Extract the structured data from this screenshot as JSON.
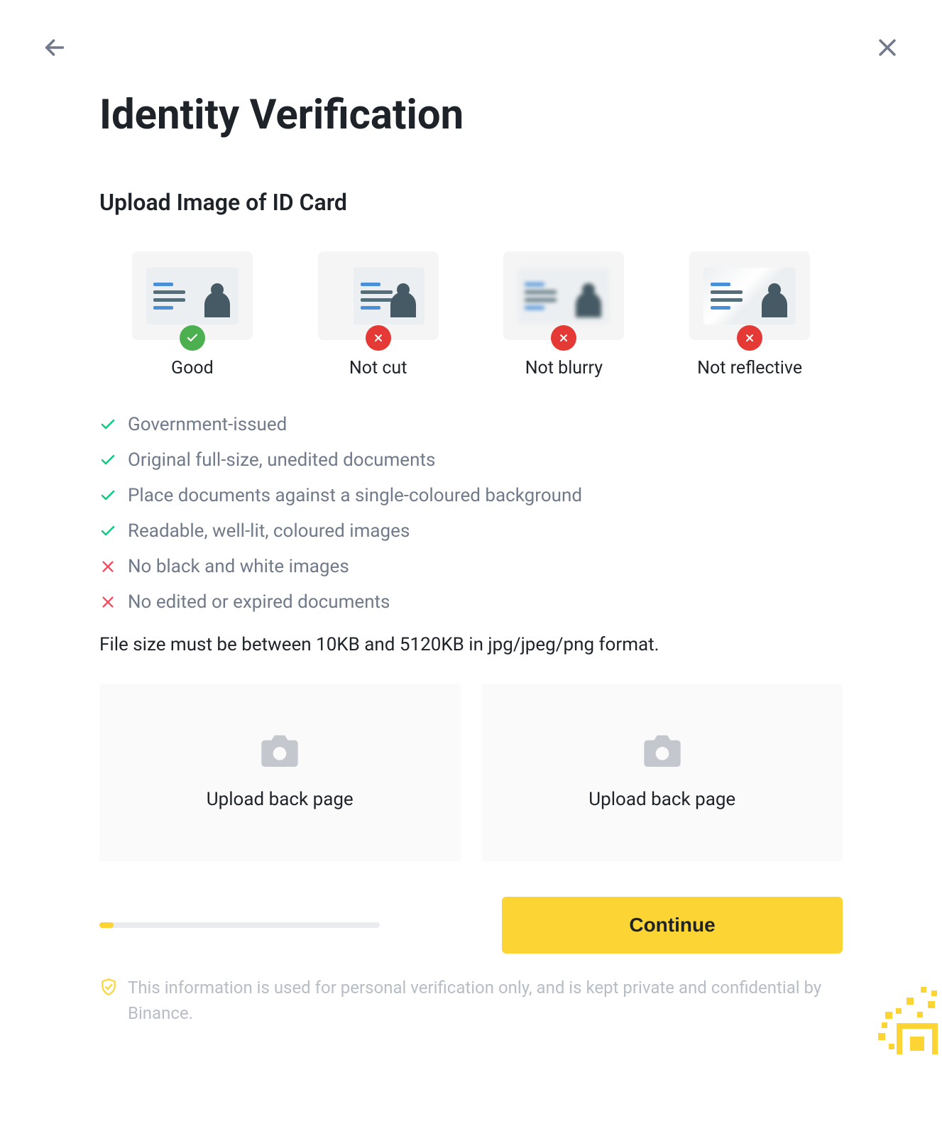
{
  "header": {
    "title": "Identity Verification",
    "subtitle": "Upload Image of ID Card"
  },
  "examples": [
    {
      "label": "Good",
      "status": "good"
    },
    {
      "label": "Not cut",
      "status": "bad"
    },
    {
      "label": "Not blurry",
      "status": "bad"
    },
    {
      "label": "Not reflective",
      "status": "bad"
    }
  ],
  "requirements": [
    {
      "ok": true,
      "text": "Government-issued"
    },
    {
      "ok": true,
      "text": "Original full-size, unedited documents"
    },
    {
      "ok": true,
      "text": "Place documents against a single-coloured background"
    },
    {
      "ok": true,
      "text": "Readable, well-lit, coloured images"
    },
    {
      "ok": false,
      "text": "No black and white images"
    },
    {
      "ok": false,
      "text": "No edited or expired documents"
    }
  ],
  "file_note": "File size must be between 10KB and 5120KB in jpg/jpeg/png format.",
  "upload": {
    "left_label": "Upload back page",
    "right_label": "Upload back page"
  },
  "continue_label": "Continue",
  "disclaimer": "This information is used for personal verification only, and is kept private and confidential by Binance.",
  "progress_percent": 5,
  "colors": {
    "accent": "#fcd535",
    "success": "#0ecb81",
    "error": "#f6465d",
    "text_secondary": "#707a8a"
  }
}
